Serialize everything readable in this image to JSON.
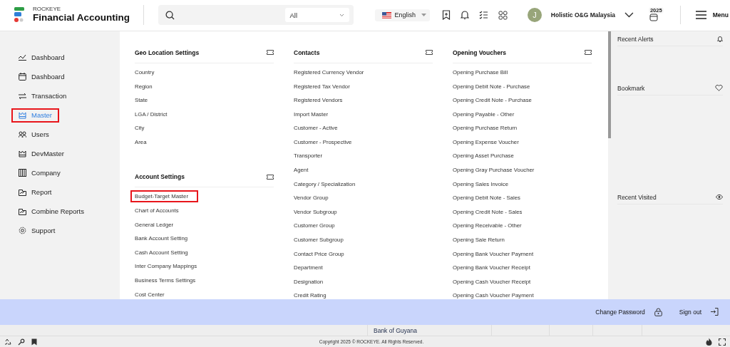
{
  "header": {
    "brand_small": "ROCKEYE",
    "brand_name": "Financial Accounting",
    "search": {
      "scope": "All"
    },
    "language": "English",
    "avatar_initial": "J",
    "company": "Holistic O&G Malaysia",
    "year_badge": "2025",
    "menu_label": "Menu"
  },
  "sidebar": {
    "items": [
      {
        "label": "Dashboard",
        "selected": false
      },
      {
        "label": "Dashboard",
        "selected": false
      },
      {
        "label": "Transaction",
        "selected": false
      },
      {
        "label": "Master",
        "selected": true
      },
      {
        "label": "Users",
        "selected": false
      },
      {
        "label": "DevMaster",
        "selected": false
      },
      {
        "label": "Company",
        "selected": false
      },
      {
        "label": "Report",
        "selected": false
      },
      {
        "label": "Combine Reports",
        "selected": false
      },
      {
        "label": "Support",
        "selected": false
      }
    ]
  },
  "menu_columns": [
    [
      {
        "title": "Geo Location Settings",
        "items": [
          {
            "label": "Country",
            "highlighted": false
          },
          {
            "label": "Region",
            "highlighted": false
          },
          {
            "label": "State",
            "highlighted": false
          },
          {
            "label": "LGA / District",
            "highlighted": false
          },
          {
            "label": "City",
            "highlighted": false
          },
          {
            "label": "Area",
            "highlighted": false
          }
        ]
      },
      {
        "title": "Account Settings",
        "items": [
          {
            "label": "Budget-Target Master",
            "highlighted": true
          },
          {
            "label": "Chart of Accounts",
            "highlighted": false
          },
          {
            "label": "General Ledger",
            "highlighted": false
          },
          {
            "label": "Bank Account Setting",
            "highlighted": false
          },
          {
            "label": "Cash Account Setting",
            "highlighted": false
          },
          {
            "label": "Inter Company Mappings",
            "highlighted": false
          },
          {
            "label": "Business Terms Settings",
            "highlighted": false
          },
          {
            "label": "Cost Center",
            "highlighted": false
          }
        ]
      }
    ],
    [
      {
        "title": "Contacts",
        "items": [
          {
            "label": "Registered Currency Vendor",
            "highlighted": false
          },
          {
            "label": "Registered Tax Vendor",
            "highlighted": false
          },
          {
            "label": "Registered Vendors",
            "highlighted": false
          },
          {
            "label": "Import Master",
            "highlighted": false
          },
          {
            "label": "Customer - Active",
            "highlighted": false
          },
          {
            "label": "Customer - Prospective",
            "highlighted": false
          },
          {
            "label": "Transporter",
            "highlighted": false
          },
          {
            "label": "Agent",
            "highlighted": false
          },
          {
            "label": "Category / Specialization",
            "highlighted": false
          },
          {
            "label": "Vendor Group",
            "highlighted": false
          },
          {
            "label": "Vendor Subgroup",
            "highlighted": false
          },
          {
            "label": "Customer Group",
            "highlighted": false
          },
          {
            "label": "Customer Subgroup",
            "highlighted": false
          },
          {
            "label": "Contact Price Group",
            "highlighted": false
          },
          {
            "label": "Department",
            "highlighted": false
          },
          {
            "label": "Designation",
            "highlighted": false
          },
          {
            "label": "Credit Rating",
            "highlighted": false
          }
        ]
      }
    ],
    [
      {
        "title": "Opening Vouchers",
        "items": [
          {
            "label": "Opening Purchase Bill",
            "highlighted": false
          },
          {
            "label": "Opening Debit Note - Purchase",
            "highlighted": false
          },
          {
            "label": "Opening Credit Note - Purchase",
            "highlighted": false
          },
          {
            "label": "Opening Payable - Other",
            "highlighted": false
          },
          {
            "label": "Opening Purchase Return",
            "highlighted": false
          },
          {
            "label": "Opening Expense Voucher",
            "highlighted": false
          },
          {
            "label": "Opening Asset Purchase",
            "highlighted": false
          },
          {
            "label": "Opening Gray Purchase Voucher",
            "highlighted": false
          },
          {
            "label": "Opening Sales Invoice",
            "highlighted": false
          },
          {
            "label": "Opening Debit Note - Sales",
            "highlighted": false
          },
          {
            "label": "Opening Credit Note - Sales",
            "highlighted": false
          },
          {
            "label": "Opening Receivable - Other",
            "highlighted": false
          },
          {
            "label": "Opening Sale Return",
            "highlighted": false
          },
          {
            "label": "Opening Bank Voucher Payment",
            "highlighted": false
          },
          {
            "label": "Opening Bank Voucher Receipt",
            "highlighted": false
          },
          {
            "label": "Opening Cash Voucher Receipt",
            "highlighted": false
          },
          {
            "label": "Opening Cash Voucher Payment",
            "highlighted": false
          }
        ]
      }
    ]
  ],
  "right_panel": [
    {
      "title": "Recent Alerts"
    },
    {
      "title": "Bookmark"
    },
    {
      "title": "Recent Visited"
    }
  ],
  "account_bar": {
    "change_password": "Change Password",
    "sign_out": "Sign out"
  },
  "background_row": {
    "cell": "Bank of Guyana"
  },
  "footer": {
    "copyright": "Copyright 2025 © ROCKEYE. All Rights Reserved."
  }
}
